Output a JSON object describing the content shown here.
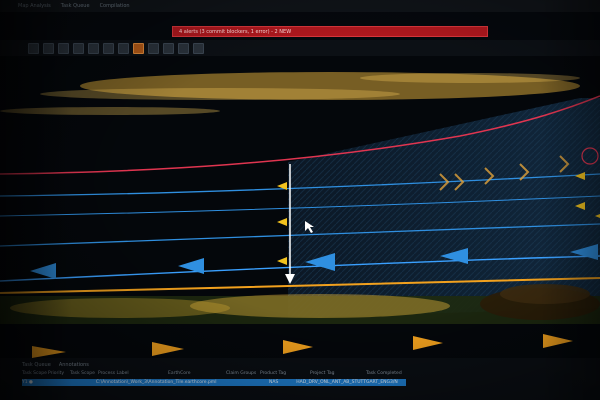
{
  "menu": {
    "items": [
      "Map Analysis",
      "Task Queue",
      "Compilation"
    ]
  },
  "alert": {
    "text": "4 alerts (3 commit blockers, 1 error) - 2 NEW"
  },
  "panel": {
    "tabs": [
      "Task Queue",
      "Annotations"
    ]
  },
  "grid": {
    "columns": [
      "Task Scope",
      "Priority",
      "Task Scope",
      "Process Label",
      "EarthCore",
      "Claim Groups",
      "Product Tag",
      "Project Tag",
      "Task Completed"
    ],
    "row": [
      "Y1 ●",
      "",
      "",
      "C:\\Annotation\\_Work_3\\Annotation_Tile.earthcore.pml",
      "",
      "",
      "NAS",
      "HAD_DRV_ONL_ANT_AB_STUTTGART_ENG3/N",
      ""
    ]
  },
  "colors": {
    "alert_bg": "#b0181e",
    "lane_blue": "#2f8fe0",
    "lane_orange": "#f2a11e",
    "lane_red": "#e03550",
    "selection": "#1f7fd1"
  }
}
